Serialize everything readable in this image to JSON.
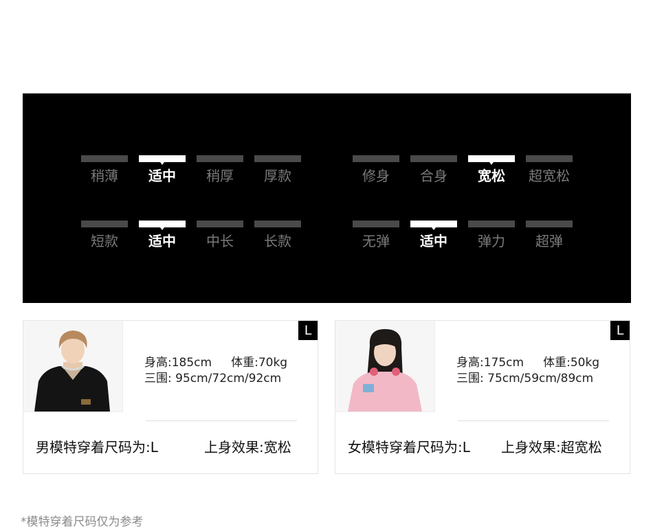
{
  "fit_panel": {
    "thickness": {
      "options": [
        "稍薄",
        "适中",
        "稍厚",
        "厚款"
      ],
      "selected": 1
    },
    "silhouette": {
      "options": [
        "修身",
        "合身",
        "宽松",
        "超宽松"
      ],
      "selected": 2
    },
    "length": {
      "options": [
        "短款",
        "适中",
        "中长",
        "长款"
      ],
      "selected": 1
    },
    "elasticity": {
      "options": [
        "无弹",
        "适中",
        "弹力",
        "超弹"
      ],
      "selected": 1
    }
  },
  "models": [
    {
      "badge": "L",
      "height": "身高:185cm",
      "weight": "体重:70kg",
      "measurements": "三围: 95cm/72cm/92cm",
      "size_text": "男模特穿着尺码为:L",
      "effect_text": "上身效果:宽松"
    },
    {
      "badge": "L",
      "height": "身高:175cm",
      "weight": "体重:50kg",
      "measurements": "三围: 75cm/59cm/89cm",
      "size_text": "女模特穿着尺码为:L",
      "effect_text": "上身效果:超宽松"
    }
  ],
  "footnote": "*模特穿着尺码仅为参考"
}
